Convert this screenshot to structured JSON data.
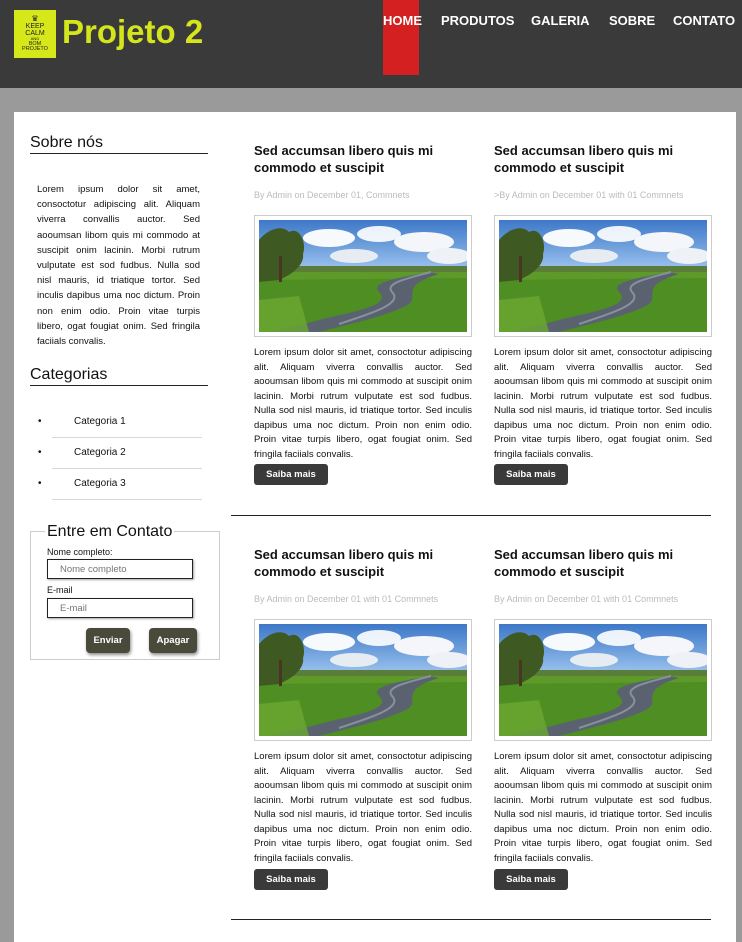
{
  "header": {
    "logo": {
      "crown": "♛",
      "line1": "KEEP",
      "line2": "CALM",
      "line3": "AND",
      "line4": "BOM",
      "line5": "PROJETO"
    },
    "title": "Projeto 2",
    "accent_color": "#d4e51c",
    "nav": [
      {
        "label": "HOME",
        "active": true
      },
      {
        "label": "PRODUTOS",
        "active": false
      },
      {
        "label": "GALERIA",
        "active": false
      },
      {
        "label": "SOBRE",
        "active": false
      },
      {
        "label": "CONTATO",
        "active": false
      }
    ],
    "nav_active_color": "#d42020"
  },
  "sidebar": {
    "about_title": "Sobre nós",
    "about_text": "Lorem ipsum dolor sit amet, consoctotur adipiscing alit. Aliquam viverra convallis auctor. Sed aooumsan libom quis mi commodo at suscipit onim lacinin. Morbi rutrum vulputate est sod fudbus. Nulla sod nisl mauris, id triatique tortor. Sed inculis dapibus uma noc dictum. Proin non enim odio. Proin vitae turpis libero, ogat fougiat onim. Sed fringila faciials convalis.",
    "categories_title": "Categorias",
    "categories": [
      "Categoria 1",
      "Categoria 2",
      "Categoria 3"
    ],
    "contact": {
      "title": "Entre em Contato",
      "name_label": "Nome completo:",
      "name_placeholder": "Nome completo",
      "email_label": "E-mail",
      "email_placeholder": "E-mail",
      "send_label": "Enviar",
      "clear_label": "Apagar"
    }
  },
  "posts": [
    {
      "title": "Sed accumsan libero quis mi commodo et suscipit",
      "meta": "By Admin on December 01, Commnets",
      "text": "Lorem ipsum dolor sit amet, consoctotur adipiscing alit. Aliquam viverra convallis auctor. Sed aooumsan libom quis mi commodo at suscipit onim lacinin. Morbi rutrum vulputate est sod fudbus. Nulla sod nisl mauris, id triatique tortor. Sed inculis dapibus uma noc dictum. Proin non enim odio. Proin vitae turpis libero, ogat fougiat onim. Sed fringila faciials convalis.",
      "button": "Saiba mais"
    },
    {
      "title": "Sed accumsan libero quis mi commodo et suscipit",
      "meta": ">By Admin on December 01 with 01 Commnets",
      "text": "Lorem ipsum dolor sit amet, consoctotur adipiscing alit. Aliquam viverra convallis auctor. Sed aooumsan libom quis mi commodo at suscipit onim lacinin. Morbi rutrum vulputate est sod fudbus. Nulla sod nisl mauris, id triatique tortor. Sed inculis dapibus uma noc dictum. Proin non enim odio. Proin vitae turpis libero, ogat fougiat onim. Sed fringila faciials convalis.",
      "button": "Saiba mais"
    },
    {
      "title": "Sed accumsan libero quis mi commodo et suscipit",
      "meta": "By Admin on December 01 with 01 Commnets",
      "text": "Lorem ipsum dolor sit amet, consoctotur adipiscing alit. Aliquam viverra convallis auctor. Sed aooumsan libom quis mi commodo at suscipit onim lacinin. Morbi rutrum vulputate est sod fudbus. Nulla sod nisl mauris, id triatique tortor. Sed inculis dapibus uma noc dictum. Proin non enim odio. Proin vitae turpis libero, ogat fougiat onim. Sed fringila faciials convalis.",
      "button": "Saiba mais"
    },
    {
      "title": "Sed accumsan libero quis mi commodo et suscipit",
      "meta": "By Admin on December 01 with 01 Commnets",
      "text": "Lorem ipsum dolor sit amet, consoctotur adipiscing alit. Aliquam viverra convallis auctor. Sed aooumsan libom quis mi commodo at suscipit onim lacinin. Morbi rutrum vulputate est sod fudbus. Nulla sod nisl mauris, id triatique tortor. Sed inculis dapibus uma noc dictum. Proin non enim odio. Proin vitae turpis libero, ogat fougiat onim. Sed fringila faciials convalis.",
      "button": "Saiba mais"
    }
  ]
}
